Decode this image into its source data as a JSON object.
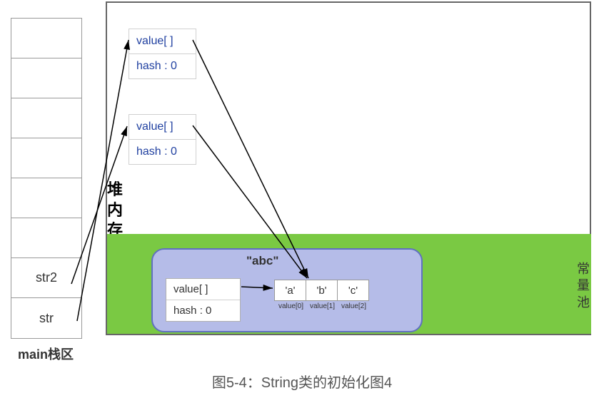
{
  "stack": {
    "label": "main栈区",
    "cells": [
      "",
      "",
      "",
      "",
      "",
      "",
      "str2",
      "str"
    ]
  },
  "heap": {
    "label": [
      "堆",
      "内",
      "存"
    ],
    "obj1": {
      "value_field": "value[ ]",
      "hash_field": "hash : 0"
    },
    "obj2": {
      "value_field": "value[ ]",
      "hash_field": "hash : 0"
    }
  },
  "constpool": {
    "label": [
      "常",
      "量",
      "池"
    ],
    "literal": "\"abc\"",
    "obj": {
      "value_field": "value[ ]",
      "hash_field": "hash : 0"
    },
    "array": [
      {
        "val": "'a'",
        "idx": "value[0]"
      },
      {
        "val": "'b'",
        "idx": "value[1]"
      },
      {
        "val": "'c'",
        "idx": "value[2]"
      }
    ]
  },
  "caption": "图5-4：String类的初始化图4"
}
